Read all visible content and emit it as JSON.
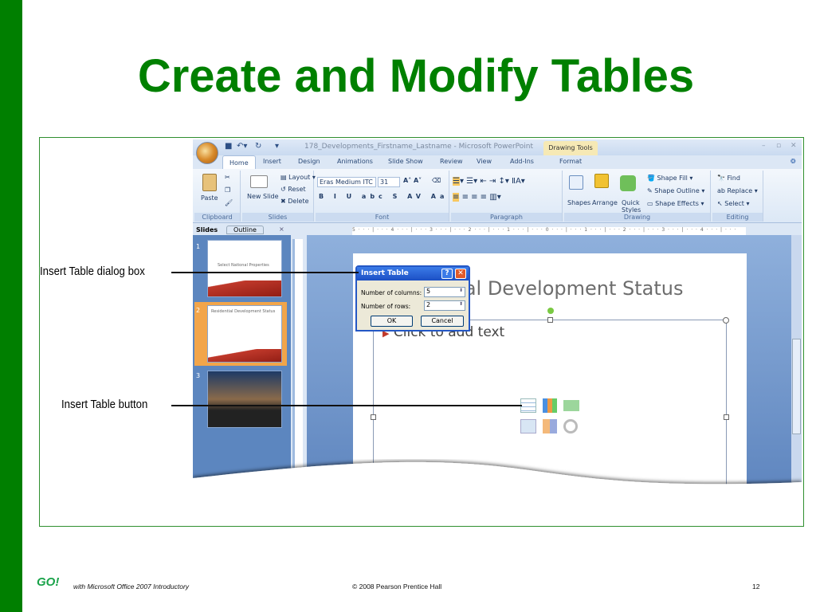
{
  "slide_title": "Create and Modify Tables",
  "app": {
    "doc_title": "178_Developments_Firstname_Lastname - Microsoft PowerPoint",
    "context_tab": "Drawing Tools",
    "tabs": [
      "Home",
      "Insert",
      "Design",
      "Animations",
      "Slide Show",
      "Review",
      "View",
      "Add-Ins",
      "Format"
    ],
    "ribbon": {
      "clipboard": {
        "label": "Clipboard",
        "paste": "Paste"
      },
      "slides": {
        "label": "Slides",
        "new_slide": "New Slide",
        "layout": "Layout",
        "reset": "Reset",
        "delete": "Delete"
      },
      "font": {
        "label": "Font",
        "font_name": "Eras Medium ITC",
        "font_size": "31"
      },
      "paragraph": {
        "label": "Paragraph"
      },
      "drawing": {
        "label": "Drawing",
        "shapes": "Shapes",
        "arrange": "Arrange",
        "quick_styles": "Quick Styles",
        "shape_fill": "Shape Fill",
        "shape_outline": "Shape Outline",
        "shape_effects": "Shape Effects"
      },
      "editing": {
        "label": "Editing",
        "find": "Find",
        "replace": "Replace",
        "select": "Select"
      }
    },
    "pane_tabs": [
      "Slides",
      "Outline"
    ],
    "ruler": "5 · · · | · · · 4 · · · | · · · 3 · · · | · · · 2 · · · | · · · 1 · · · | · · · 0 · · · | · · · 1 · · · | · · · 2 · · · | · · · 3 · · · | · · · 4 · · · | · · ·",
    "thumbnails": [
      {
        "num": "1",
        "text": "Select National Properties"
      },
      {
        "num": "2",
        "text": "Residential Development Status"
      },
      {
        "num": "3",
        "text": ""
      }
    ],
    "slide": {
      "title": "Residential Development Status",
      "placeholder": "Click to add text"
    },
    "dialog": {
      "title": "Insert Table",
      "columns_label": "Number of columns:",
      "columns_value": "5",
      "rows_label": "Number of rows:",
      "rows_value": "2",
      "ok": "OK",
      "cancel": "Cancel"
    }
  },
  "callouts": {
    "dialog": "Insert Table dialog box",
    "button": "Insert Table button"
  },
  "footer": {
    "logo": "GO!",
    "book": "with Microsoft Office 2007 Introductory",
    "copyright": "© 2008 Pearson Prentice Hall",
    "page": "12"
  },
  "colors": {
    "green": "#008000",
    "ribbon": "#dce8f6",
    "dialog_title": "#1b4fc4"
  }
}
